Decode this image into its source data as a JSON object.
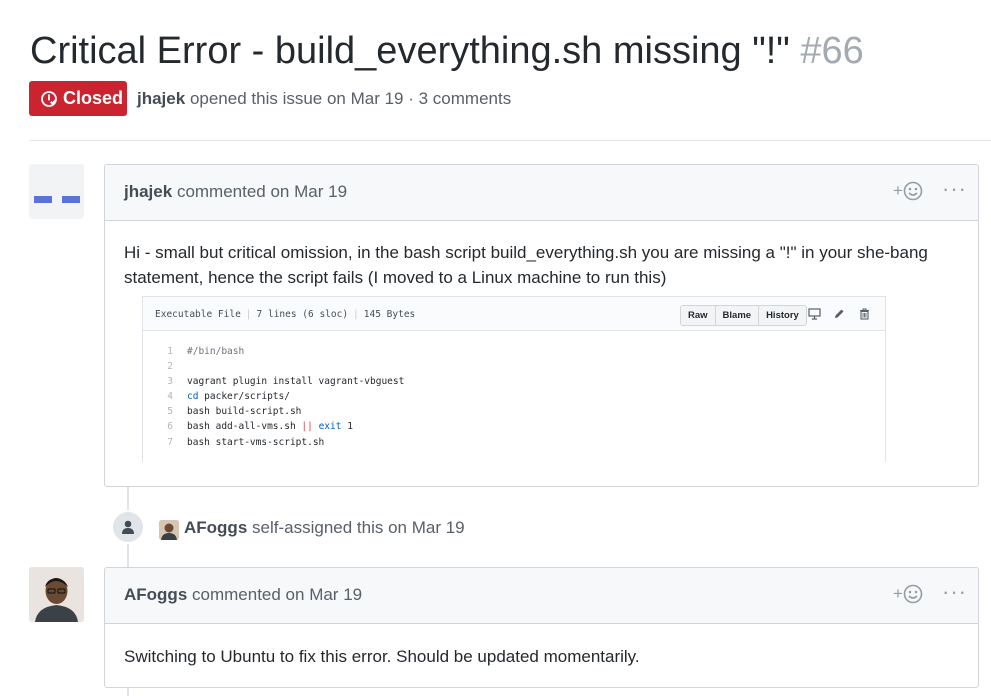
{
  "issue": {
    "title": "Critical Error - build_everything.sh missing \"!\"",
    "number": "#66",
    "state": "Closed",
    "author": "jhajek",
    "meta_text": "opened this issue on Mar 19 · 3 comments"
  },
  "comments": [
    {
      "author": "jhajek",
      "action": "commented on Mar 19",
      "reaction_icon": "smiley-plus",
      "more_label": "···",
      "body": "Hi - small but critical omission, in the bash script build_everything.sh you are missing a \"!\" in your she-bang statement, hence the script fails (I moved to a Linux machine to run this)"
    },
    {
      "author": "AFoggs",
      "action": "commented on Mar 19",
      "reaction_icon": "smiley-plus",
      "more_label": "···",
      "body": "Switching to Ubuntu to fix this error. Should be updated momentarily."
    }
  ],
  "file_view": {
    "kind": "Executable File",
    "lines": "7 lines (6 sloc)",
    "size": "145 Bytes",
    "buttons": [
      "Raw",
      "Blame",
      "History"
    ],
    "icons": [
      "desktop-icon",
      "pencil-icon",
      "trash-icon"
    ],
    "code": [
      {
        "n": "1",
        "text": "#/bin/bash"
      },
      {
        "n": "2",
        "text": ""
      },
      {
        "n": "3",
        "text": "vagrant plugin install vagrant-vbguest"
      },
      {
        "n": "4",
        "text": "cd packer/scripts/"
      },
      {
        "n": "5",
        "text": "bash build-script.sh"
      },
      {
        "n": "6",
        "text": "bash add-all-vms.sh || exit 1"
      },
      {
        "n": "7",
        "text": "bash start-vms-script.sh"
      }
    ]
  },
  "event": {
    "actor": "AFoggs",
    "text": "self-assigned this on Mar 19"
  },
  "colors": {
    "closed_red": "#cb2431",
    "link_blue": "#005cc5",
    "identicon_blue": "#5a73d6"
  }
}
